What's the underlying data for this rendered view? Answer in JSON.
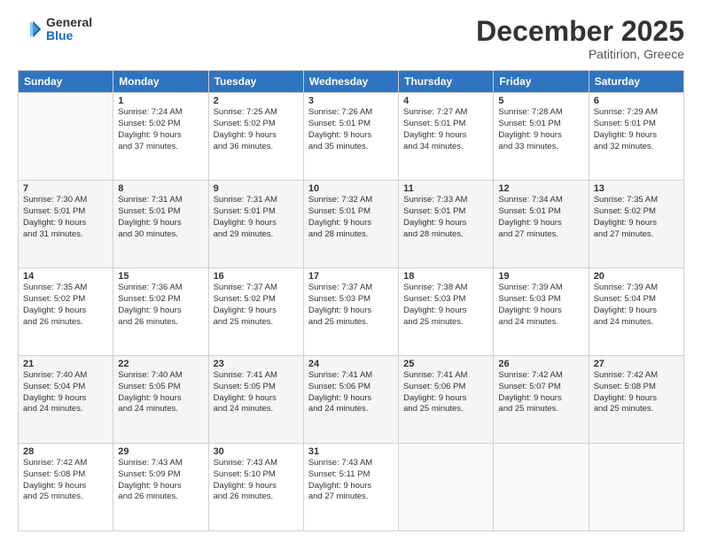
{
  "header": {
    "logo_general": "General",
    "logo_blue": "Blue",
    "month": "December 2025",
    "location": "Patitirion, Greece"
  },
  "weekdays": [
    "Sunday",
    "Monday",
    "Tuesday",
    "Wednesday",
    "Thursday",
    "Friday",
    "Saturday"
  ],
  "weeks": [
    [
      {
        "day": "",
        "info": ""
      },
      {
        "day": "1",
        "info": "Sunrise: 7:24 AM\nSunset: 5:02 PM\nDaylight: 9 hours\nand 37 minutes."
      },
      {
        "day": "2",
        "info": "Sunrise: 7:25 AM\nSunset: 5:02 PM\nDaylight: 9 hours\nand 36 minutes."
      },
      {
        "day": "3",
        "info": "Sunrise: 7:26 AM\nSunset: 5:01 PM\nDaylight: 9 hours\nand 35 minutes."
      },
      {
        "day": "4",
        "info": "Sunrise: 7:27 AM\nSunset: 5:01 PM\nDaylight: 9 hours\nand 34 minutes."
      },
      {
        "day": "5",
        "info": "Sunrise: 7:28 AM\nSunset: 5:01 PM\nDaylight: 9 hours\nand 33 minutes."
      },
      {
        "day": "6",
        "info": "Sunrise: 7:29 AM\nSunset: 5:01 PM\nDaylight: 9 hours\nand 32 minutes."
      }
    ],
    [
      {
        "day": "7",
        "info": "Sunrise: 7:30 AM\nSunset: 5:01 PM\nDaylight: 9 hours\nand 31 minutes."
      },
      {
        "day": "8",
        "info": "Sunrise: 7:31 AM\nSunset: 5:01 PM\nDaylight: 9 hours\nand 30 minutes."
      },
      {
        "day": "9",
        "info": "Sunrise: 7:31 AM\nSunset: 5:01 PM\nDaylight: 9 hours\nand 29 minutes."
      },
      {
        "day": "10",
        "info": "Sunrise: 7:32 AM\nSunset: 5:01 PM\nDaylight: 9 hours\nand 28 minutes."
      },
      {
        "day": "11",
        "info": "Sunrise: 7:33 AM\nSunset: 5:01 PM\nDaylight: 9 hours\nand 28 minutes."
      },
      {
        "day": "12",
        "info": "Sunrise: 7:34 AM\nSunset: 5:01 PM\nDaylight: 9 hours\nand 27 minutes."
      },
      {
        "day": "13",
        "info": "Sunrise: 7:35 AM\nSunset: 5:02 PM\nDaylight: 9 hours\nand 27 minutes."
      }
    ],
    [
      {
        "day": "14",
        "info": "Sunrise: 7:35 AM\nSunset: 5:02 PM\nDaylight: 9 hours\nand 26 minutes."
      },
      {
        "day": "15",
        "info": "Sunrise: 7:36 AM\nSunset: 5:02 PM\nDaylight: 9 hours\nand 26 minutes."
      },
      {
        "day": "16",
        "info": "Sunrise: 7:37 AM\nSunset: 5:02 PM\nDaylight: 9 hours\nand 25 minutes."
      },
      {
        "day": "17",
        "info": "Sunrise: 7:37 AM\nSunset: 5:03 PM\nDaylight: 9 hours\nand 25 minutes."
      },
      {
        "day": "18",
        "info": "Sunrise: 7:38 AM\nSunset: 5:03 PM\nDaylight: 9 hours\nand 25 minutes."
      },
      {
        "day": "19",
        "info": "Sunrise: 7:39 AM\nSunset: 5:03 PM\nDaylight: 9 hours\nand 24 minutes."
      },
      {
        "day": "20",
        "info": "Sunrise: 7:39 AM\nSunset: 5:04 PM\nDaylight: 9 hours\nand 24 minutes."
      }
    ],
    [
      {
        "day": "21",
        "info": "Sunrise: 7:40 AM\nSunset: 5:04 PM\nDaylight: 9 hours\nand 24 minutes."
      },
      {
        "day": "22",
        "info": "Sunrise: 7:40 AM\nSunset: 5:05 PM\nDaylight: 9 hours\nand 24 minutes."
      },
      {
        "day": "23",
        "info": "Sunrise: 7:41 AM\nSunset: 5:05 PM\nDaylight: 9 hours\nand 24 minutes."
      },
      {
        "day": "24",
        "info": "Sunrise: 7:41 AM\nSunset: 5:06 PM\nDaylight: 9 hours\nand 24 minutes."
      },
      {
        "day": "25",
        "info": "Sunrise: 7:41 AM\nSunset: 5:06 PM\nDaylight: 9 hours\nand 25 minutes."
      },
      {
        "day": "26",
        "info": "Sunrise: 7:42 AM\nSunset: 5:07 PM\nDaylight: 9 hours\nand 25 minutes."
      },
      {
        "day": "27",
        "info": "Sunrise: 7:42 AM\nSunset: 5:08 PM\nDaylight: 9 hours\nand 25 minutes."
      }
    ],
    [
      {
        "day": "28",
        "info": "Sunrise: 7:42 AM\nSunset: 5:08 PM\nDaylight: 9 hours\nand 25 minutes."
      },
      {
        "day": "29",
        "info": "Sunrise: 7:43 AM\nSunset: 5:09 PM\nDaylight: 9 hours\nand 26 minutes."
      },
      {
        "day": "30",
        "info": "Sunrise: 7:43 AM\nSunset: 5:10 PM\nDaylight: 9 hours\nand 26 minutes."
      },
      {
        "day": "31",
        "info": "Sunrise: 7:43 AM\nSunset: 5:11 PM\nDaylight: 9 hours\nand 27 minutes."
      },
      {
        "day": "",
        "info": ""
      },
      {
        "day": "",
        "info": ""
      },
      {
        "day": "",
        "info": ""
      }
    ]
  ]
}
